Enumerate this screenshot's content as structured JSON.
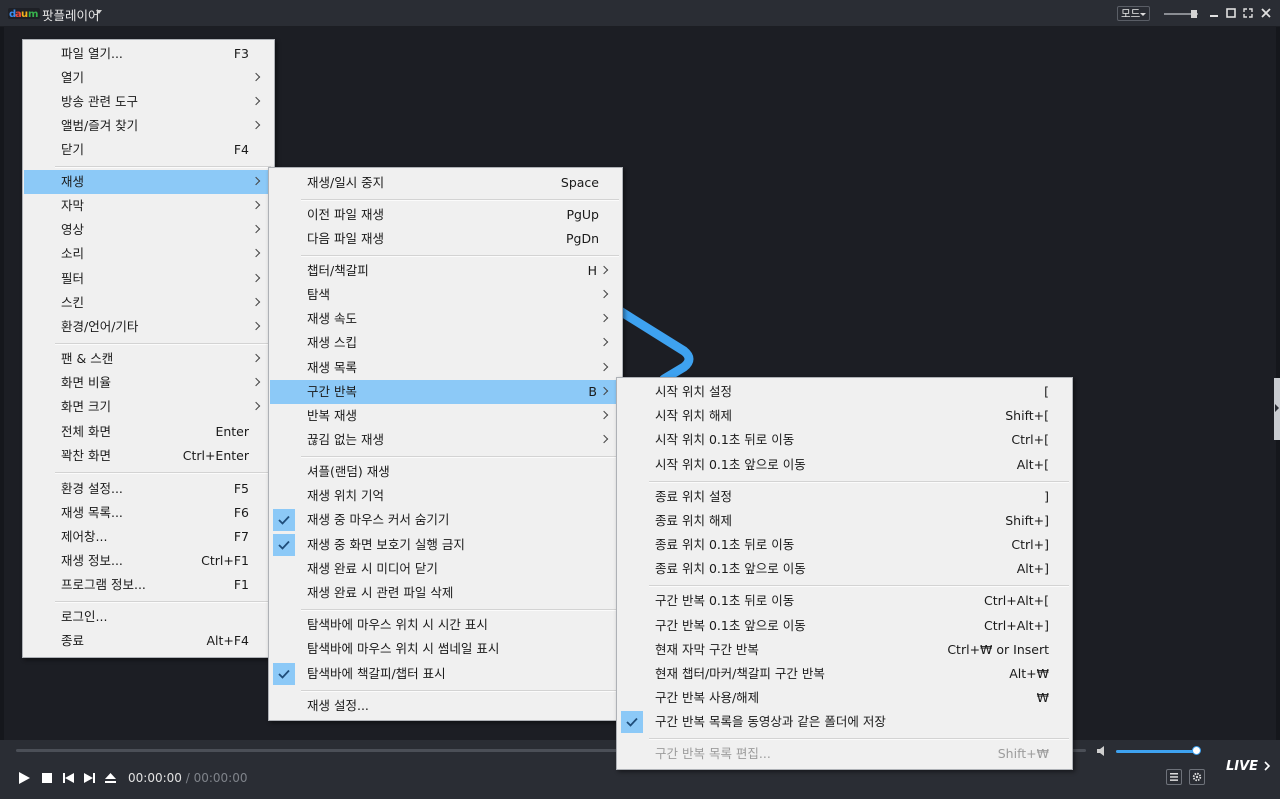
{
  "title_bar": {
    "app_title": "팟플레이어",
    "mode_label": "모드"
  },
  "controls": {
    "time_current": "00:00:00",
    "time_separator": " / ",
    "time_total": "00:00:00",
    "live_label": "LIVE",
    "volume_fraction": 0.95
  },
  "main_menu": {
    "items": [
      {
        "label": "파일 열기...",
        "shortcut": "F3"
      },
      {
        "label": "열기",
        "submenu": true
      },
      {
        "label": "방송 관련 도구",
        "submenu": true
      },
      {
        "label": "앨범/즐겨 찾기",
        "submenu": true
      },
      {
        "label": "닫기",
        "shortcut": "F4"
      },
      {
        "label": "재생",
        "submenu": true,
        "highlighted": true
      },
      {
        "label": "자막",
        "submenu": true
      },
      {
        "label": "영상",
        "submenu": true
      },
      {
        "label": "소리",
        "submenu": true
      },
      {
        "label": "필터",
        "submenu": true
      },
      {
        "label": "스킨",
        "submenu": true
      },
      {
        "label": "환경/언어/기타",
        "submenu": true
      },
      {
        "label": "팬 & 스캔",
        "submenu": true
      },
      {
        "label": "화면 비율",
        "submenu": true
      },
      {
        "label": "화면 크기",
        "submenu": true
      },
      {
        "label": "전체 화면",
        "shortcut": "Enter"
      },
      {
        "label": "꽉찬 화면",
        "shortcut": "Ctrl+Enter"
      },
      {
        "label": "환경 설정...",
        "shortcut": "F5"
      },
      {
        "label": "재생 목록...",
        "shortcut": "F6"
      },
      {
        "label": "제어창...",
        "shortcut": "F7"
      },
      {
        "label": "재생 정보...",
        "shortcut": "Ctrl+F1"
      },
      {
        "label": "프로그램 정보...",
        "shortcut": "F1"
      },
      {
        "label": "로그인..."
      },
      {
        "label": "종료",
        "shortcut": "Alt+F4"
      }
    ]
  },
  "play_menu": {
    "items": [
      {
        "label": "재생/일시 중지",
        "shortcut": "Space"
      },
      {
        "label": "이전 파일 재생",
        "shortcut": "PgUp"
      },
      {
        "label": "다음 파일 재생",
        "shortcut": "PgDn"
      },
      {
        "label": "챕터/책갈피",
        "shortcut": "H",
        "submenu": true
      },
      {
        "label": "탐색",
        "submenu": true
      },
      {
        "label": "재생 속도",
        "submenu": true
      },
      {
        "label": "재생 스킵",
        "submenu": true
      },
      {
        "label": "재생 목록",
        "submenu": true
      },
      {
        "label": "구간 반복",
        "shortcut": "B",
        "submenu": true,
        "highlighted": true
      },
      {
        "label": "반복 재생",
        "submenu": true
      },
      {
        "label": "끊김 없는 재생",
        "submenu": true
      },
      {
        "label": "셔플(랜덤) 재생"
      },
      {
        "label": "재생 위치 기억"
      },
      {
        "label": "재생 중 마우스 커서 숨기기",
        "checked": true
      },
      {
        "label": "재생 중 화면 보호기 실행 금지",
        "checked": true
      },
      {
        "label": "재생 완료 시 미디어 닫기"
      },
      {
        "label": "재생 완료 시 관련 파일 삭제"
      },
      {
        "label": "탐색바에 마우스 위치 시 시간 표시"
      },
      {
        "label": "탐색바에 마우스 위치 시 썸네일 표시"
      },
      {
        "label": "탐색바에 책갈피/챕터 표시",
        "checked": true
      },
      {
        "label": "재생 설정..."
      }
    ]
  },
  "ab_menu": {
    "items": [
      {
        "label": "시작 위치 설정",
        "shortcut": "["
      },
      {
        "label": "시작 위치 해제",
        "shortcut": "Shift+["
      },
      {
        "label": "시작 위치 0.1초 뒤로 이동",
        "shortcut": "Ctrl+["
      },
      {
        "label": "시작 위치 0.1초 앞으로 이동",
        "shortcut": "Alt+["
      },
      {
        "label": "종료 위치 설정",
        "shortcut": "]"
      },
      {
        "label": "종료 위치 해제",
        "shortcut": "Shift+]"
      },
      {
        "label": "종료 위치 0.1초 뒤로 이동",
        "shortcut": "Ctrl+]"
      },
      {
        "label": "종료 위치 0.1초 앞으로 이동",
        "shortcut": "Alt+]"
      },
      {
        "label": "구간 반복 0.1초 뒤로 이동",
        "shortcut": "Ctrl+Alt+["
      },
      {
        "label": "구간 반복 0.1초 앞으로 이동",
        "shortcut": "Ctrl+Alt+]"
      },
      {
        "label": "현재 자막 구간 반복",
        "shortcut": "Ctrl+₩ or Insert"
      },
      {
        "label": "현재 챕터/마커/책갈피 구간 반복",
        "shortcut": "Alt+₩"
      },
      {
        "label": "구간 반복 사용/해제",
        "shortcut": "₩"
      },
      {
        "label": "구간 반복 목록을 동영상과 같은 폴더에 저장",
        "checked": true
      },
      {
        "label": "구간 반복 목록 편집...",
        "shortcut": "Shift+₩",
        "disabled": true
      }
    ]
  },
  "colors": {
    "menu_bg": "#f0f0f0",
    "highlight": "#8cc9f7",
    "accent_blue": "#3ea2f0",
    "titlebar": "#2a2d34",
    "video_bg": "#1c1e24"
  }
}
